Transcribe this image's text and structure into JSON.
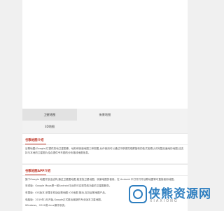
{
  "tabs": [
    {
      "label": "卫星地图",
      "active": true
    },
    {
      "label": "街景地图",
      "active": false
    },
    {
      "label": "3D地图",
      "active": false
    }
  ],
  "section1": {
    "title": "谷歌地图介绍",
    "text": "谷歌地图(Google)它提供的地卫星图像、地形和街道地图三种视图,允许使用可以通过平移视觉观察旋转的各式各看认识完整走遍地形地图,还支持与本地的卫星图片结合提供专车图的分析路线地图信息。"
  },
  "section2": {
    "title": "谷歌地图APP介绍",
    "paragraphs": [
      "旗下Google 地图开放全结构,通过卫星图地图,能查找卫星地图、街景地图的使用。在 Android 中打开开开谷歌地图等可直接使用地图。",
      "安卓版：Google Maps是一款Android平台的可实现导航功能的卫星图服务。",
      "苹果版：iOS版本,苹果手机版谷歌地图 iOS地图 推动,支持谷歌地图产品。",
      "电脑版：2019年1月开始,Google正式推出最新的专业版本卫星地图。",
      "Windows、OS X或Linux操作系统。"
    ]
  },
  "watermark": {
    "text": "侠熊资源网",
    "sub": "XIAXIONG"
  }
}
